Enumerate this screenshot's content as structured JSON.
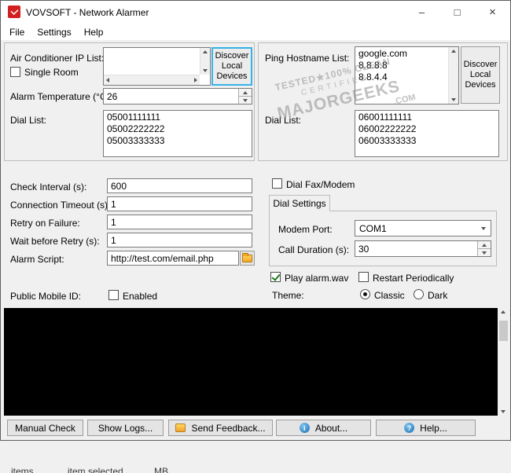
{
  "titlebar": {
    "title": "VOVSOFT - Network Alarmer",
    "minimize_glyph": "–",
    "maximize_glyph": "□",
    "close_glyph": "×"
  },
  "menu": {
    "items": [
      {
        "label": "File"
      },
      {
        "label": "Settings"
      },
      {
        "label": "Help"
      }
    ]
  },
  "left_group": {
    "ip_list_label": "Air Conditioner IP List:",
    "ip_list_value": "",
    "discover_button_label": "Discover Local Devices",
    "single_room_label": "Single Room",
    "alarm_temp_label": "Alarm Temperature (°C):",
    "alarm_temp_value": "26",
    "dial_list_label": "Dial List:",
    "dial_list_value": "05001111111\n05002222222\n05003333333"
  },
  "right_group": {
    "ping_list_label": "Ping Hostname List:",
    "ping_list_value": "google.com\n8.8.8.8\n8.8.4.4",
    "discover_button_label": "Discover Local Devices",
    "dial_list_label": "Dial List:",
    "dial_list_value": "06001111111\n06002222222\n06003333333"
  },
  "settings": {
    "check_interval_label": "Check Interval (s):",
    "check_interval_value": "600",
    "connection_timeout_label": "Connection Timeout (s):",
    "connection_timeout_value": "1",
    "retry_on_failure_label": "Retry on Failure:",
    "retry_on_failure_value": "1",
    "wait_before_retry_label": "Wait before Retry (s):",
    "wait_before_retry_value": "1",
    "alarm_script_label": "Alarm Script:",
    "alarm_script_value": "http://test.com/email.php",
    "public_mobile_id_label": "Public Mobile ID:",
    "enabled_label": "Enabled"
  },
  "modem": {
    "dial_fax_label": "Dial Fax/Modem",
    "tab_label": "Dial Settings",
    "modem_port_label": "Modem Port:",
    "modem_port_value": "COM1",
    "call_duration_label": "Call Duration (s):",
    "call_duration_value": "30"
  },
  "options": {
    "play_alarm_label": "Play alarm.wav",
    "play_alarm_checked": true,
    "restart_label": "Restart Periodically",
    "restart_checked": false,
    "theme_label": "Theme:",
    "theme_classic_label": "Classic",
    "theme_dark_label": "Dark",
    "theme_selected": "Classic"
  },
  "footer_buttons": {
    "manual_check": "Manual Check",
    "show_logs": "Show Logs...",
    "send_feedback": "Send Feedback...",
    "about": "About...",
    "help": "Help..."
  },
  "console": {
    "content": ""
  },
  "watermark": {
    "line1": "TESTED★100% CLEAN",
    "line2": "CERTIFIED",
    "line3": "MAJORGEEKS",
    "line4": ".COM"
  },
  "status_bar": {
    "items_fragment": "items",
    "selected_fragment": "item selected",
    "size_fragment": "MB"
  },
  "colors": {
    "accent_focus": "#35b2e5",
    "check_green": "#1e7a1e",
    "console_bg": "#000000",
    "titlebar_bg": "#ffffff",
    "window_bg": "#f0f0f0"
  }
}
